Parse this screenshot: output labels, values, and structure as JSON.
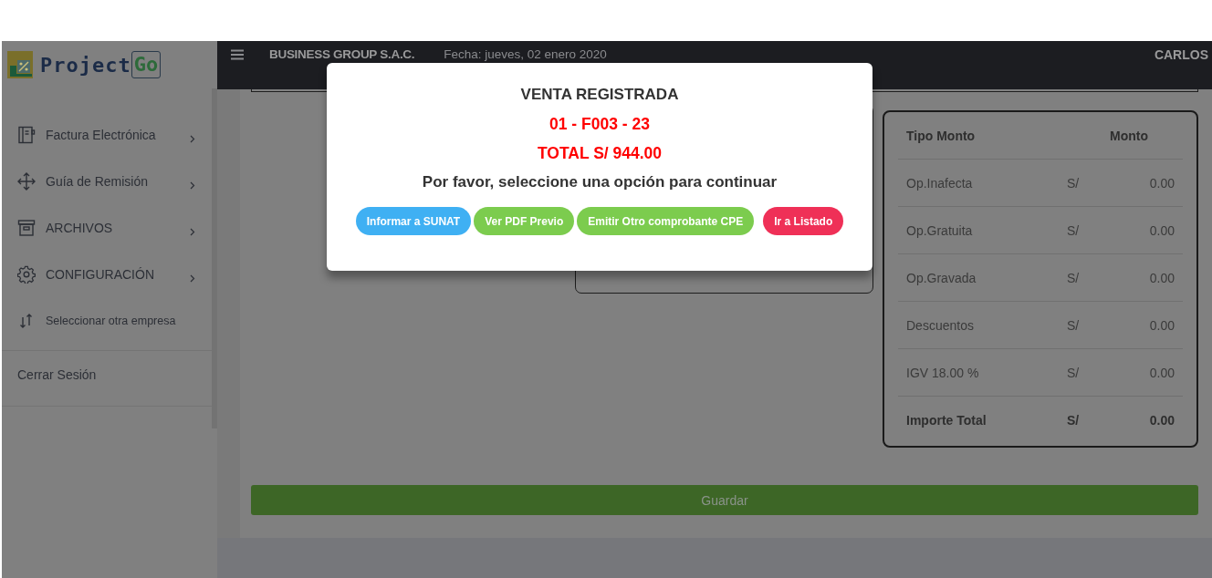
{
  "logo": {
    "text": "Project",
    "badge": "Go"
  },
  "header": {
    "company": "BUSINESS GROUP S.A.C.",
    "date": "Fecha: jueves, 02 enero 2020",
    "user": "CARLOS"
  },
  "sidebar": {
    "items": [
      {
        "label": "Factura Electrónica",
        "kind": "menu"
      },
      {
        "label": "Guía de Remisión",
        "kind": "menu"
      },
      {
        "label": "ARCHIVOS",
        "kind": "menu"
      },
      {
        "label": "CONFIGURACIÓN",
        "kind": "menu"
      },
      {
        "label": "Seleccionar otra empresa",
        "kind": "action"
      }
    ],
    "logout": "Cerrar Sesión"
  },
  "totals": {
    "columns": [
      "Tipo Monto",
      "Monto"
    ],
    "rows": [
      {
        "label": "Op.Inafecta",
        "currency": "S/",
        "amount": "0.00",
        "bold": false
      },
      {
        "label": "Op.Gratuita",
        "currency": "S/",
        "amount": "0.00",
        "bold": false
      },
      {
        "label": "Op.Gravada",
        "currency": "S/",
        "amount": "0.00",
        "bold": false
      },
      {
        "label": "Descuentos",
        "currency": "S/",
        "amount": "0.00",
        "bold": false
      },
      {
        "label": "IGV 18.00 %",
        "currency": "S/",
        "amount": "0.00",
        "bold": false
      },
      {
        "label": "Importe Total",
        "currency": "S/",
        "amount": "0.00",
        "bold": true
      }
    ]
  },
  "save_button": "Guardar",
  "modal": {
    "title": "VENTA REGISTRADA",
    "document": "01 - F003 - 23",
    "total": "TOTAL S/ 944.00",
    "prompt": "Por favor, seleccione una opción para continuar",
    "buttons": [
      {
        "label": "Informar a SUNAT",
        "color": "#3fb0f3"
      },
      {
        "label": "Ver PDF Previo",
        "color": "#7ccc4e"
      },
      {
        "label": "Emitir Otro comprobante CPE",
        "color": "#7ccc4e"
      },
      {
        "label": "Ir a Listado",
        "color": "#ef3057"
      }
    ]
  }
}
